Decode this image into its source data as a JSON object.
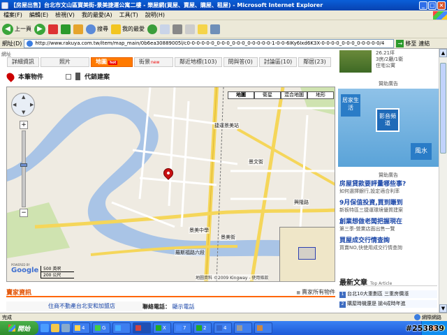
{
  "window": {
    "title": "【房屋出售】台北市文山區寶美街-景美捷運公寓二樓 - 樂屋網(買屋、賣屋、購屋、租屋) - Microsoft Internet Explorer",
    "minimize": "_",
    "maximize": "□",
    "close": "×"
  },
  "menubar": [
    "檔案(F)",
    "編輯(E)",
    "檢視(V)",
    "我的最愛(A)",
    "工具(T)",
    "說明(H)"
  ],
  "toolbar": {
    "back": "上一頁",
    "search": "搜尋",
    "favorites": "我的最愛"
  },
  "addressbar": {
    "label": "網址(D)",
    "url": "http://www.rakuya.com.tw/item/map_main/0b6ea30889005l/c0-0-0-0-0-0_0-0-0_0-0-0_0-0-0-0-0-1-0-0-6IKy6Ixd6K3X-0-0-0-0_0-0-0_0-0-0-0-0/4",
    "go": "移至",
    "links": "連結"
  },
  "page": {
    "site_label": "網址",
    "tabs": [
      {
        "label": "詳細資訊",
        "active": false
      },
      {
        "label": "照片",
        "active": false
      },
      {
        "label": "地圖",
        "active": true,
        "badge": "hot"
      },
      {
        "label": "街景",
        "active": false,
        "badge": "new"
      },
      {
        "label": "鄰近地標(103)",
        "active": false
      },
      {
        "label": "問與答(0)",
        "active": false
      },
      {
        "label": "討論區(10)",
        "active": false
      },
      {
        "label": "鄰居(23)",
        "active": false
      }
    ],
    "map_options": {
      "this_property": "本筆物件",
      "agent_cases": "代銷建案"
    },
    "map": {
      "types": [
        "地圖",
        "衛星",
        "混合地圖",
        "地形"
      ],
      "active_type": "地圖",
      "scale_imperial": "500 英呎",
      "scale_metric": "200 公尺",
      "google": "Google",
      "powered_by": "POWERED BY",
      "copyright": "地圖資料 ©2009 Kingway - 使用條款",
      "labels": {
        "jingmei_station": "捷運景美站",
        "jingmei_middle": "景美中學",
        "jingmei_st": "景美街",
        "roosevelt": "羅斯福路六段",
        "jingwen_st": "景文街",
        "xinglong": "興隆路"
      }
    },
    "agent_section": {
      "title": "賣家資訊",
      "all_link": "賣家所有物件",
      "agent_name": "住商不動產台北安和加盟店",
      "phone_label": "聯絡電話：",
      "phone_link": "顯示電話"
    }
  },
  "sidebar": {
    "top_text": [
      "26.21坪",
      "3房/2廳/1衛",
      "住宅公寓"
    ],
    "ad_title_1": "贊助廣告",
    "banner": {
      "b1": "居家生活",
      "b2": "影音頻道",
      "b3": "風水"
    },
    "ad_title_2": "贊助廣告",
    "ads": [
      {
        "head": "房屋貸款要評量哪些事?",
        "sub": "如何選擇銀行,設定適合利率"
      },
      {
        "head": "9月保值投資,買到賺到",
        "sub": "新板特區三捷運環境優質建案"
      },
      {
        "head": "創業想做老闆把握現在",
        "sub": "第三季-營業店面出售一覽"
      },
      {
        "head": "買屋成交行情查詢",
        "sub": "買賣NO,快使用成交行情查詢"
      }
    ],
    "latest_title": "最新文章",
    "latest_sub": "Top Article",
    "latest": [
      {
        "num": "1",
        "text": "台北10大重劃區 三重房價漲"
      },
      {
        "num": "2",
        "text": "購屋時機還是 搶4成時年進"
      }
    ]
  },
  "statusbar": {
    "text": "完成",
    "zone": "網際網路"
  },
  "taskbar": {
    "start": "開始",
    "items": [
      "4",
      "G",
      "",
      "",
      "X",
      "7",
      "2",
      "4",
      "",
      "",
      ""
    ],
    "tray_time": "",
    "watermark": "#253839"
  }
}
